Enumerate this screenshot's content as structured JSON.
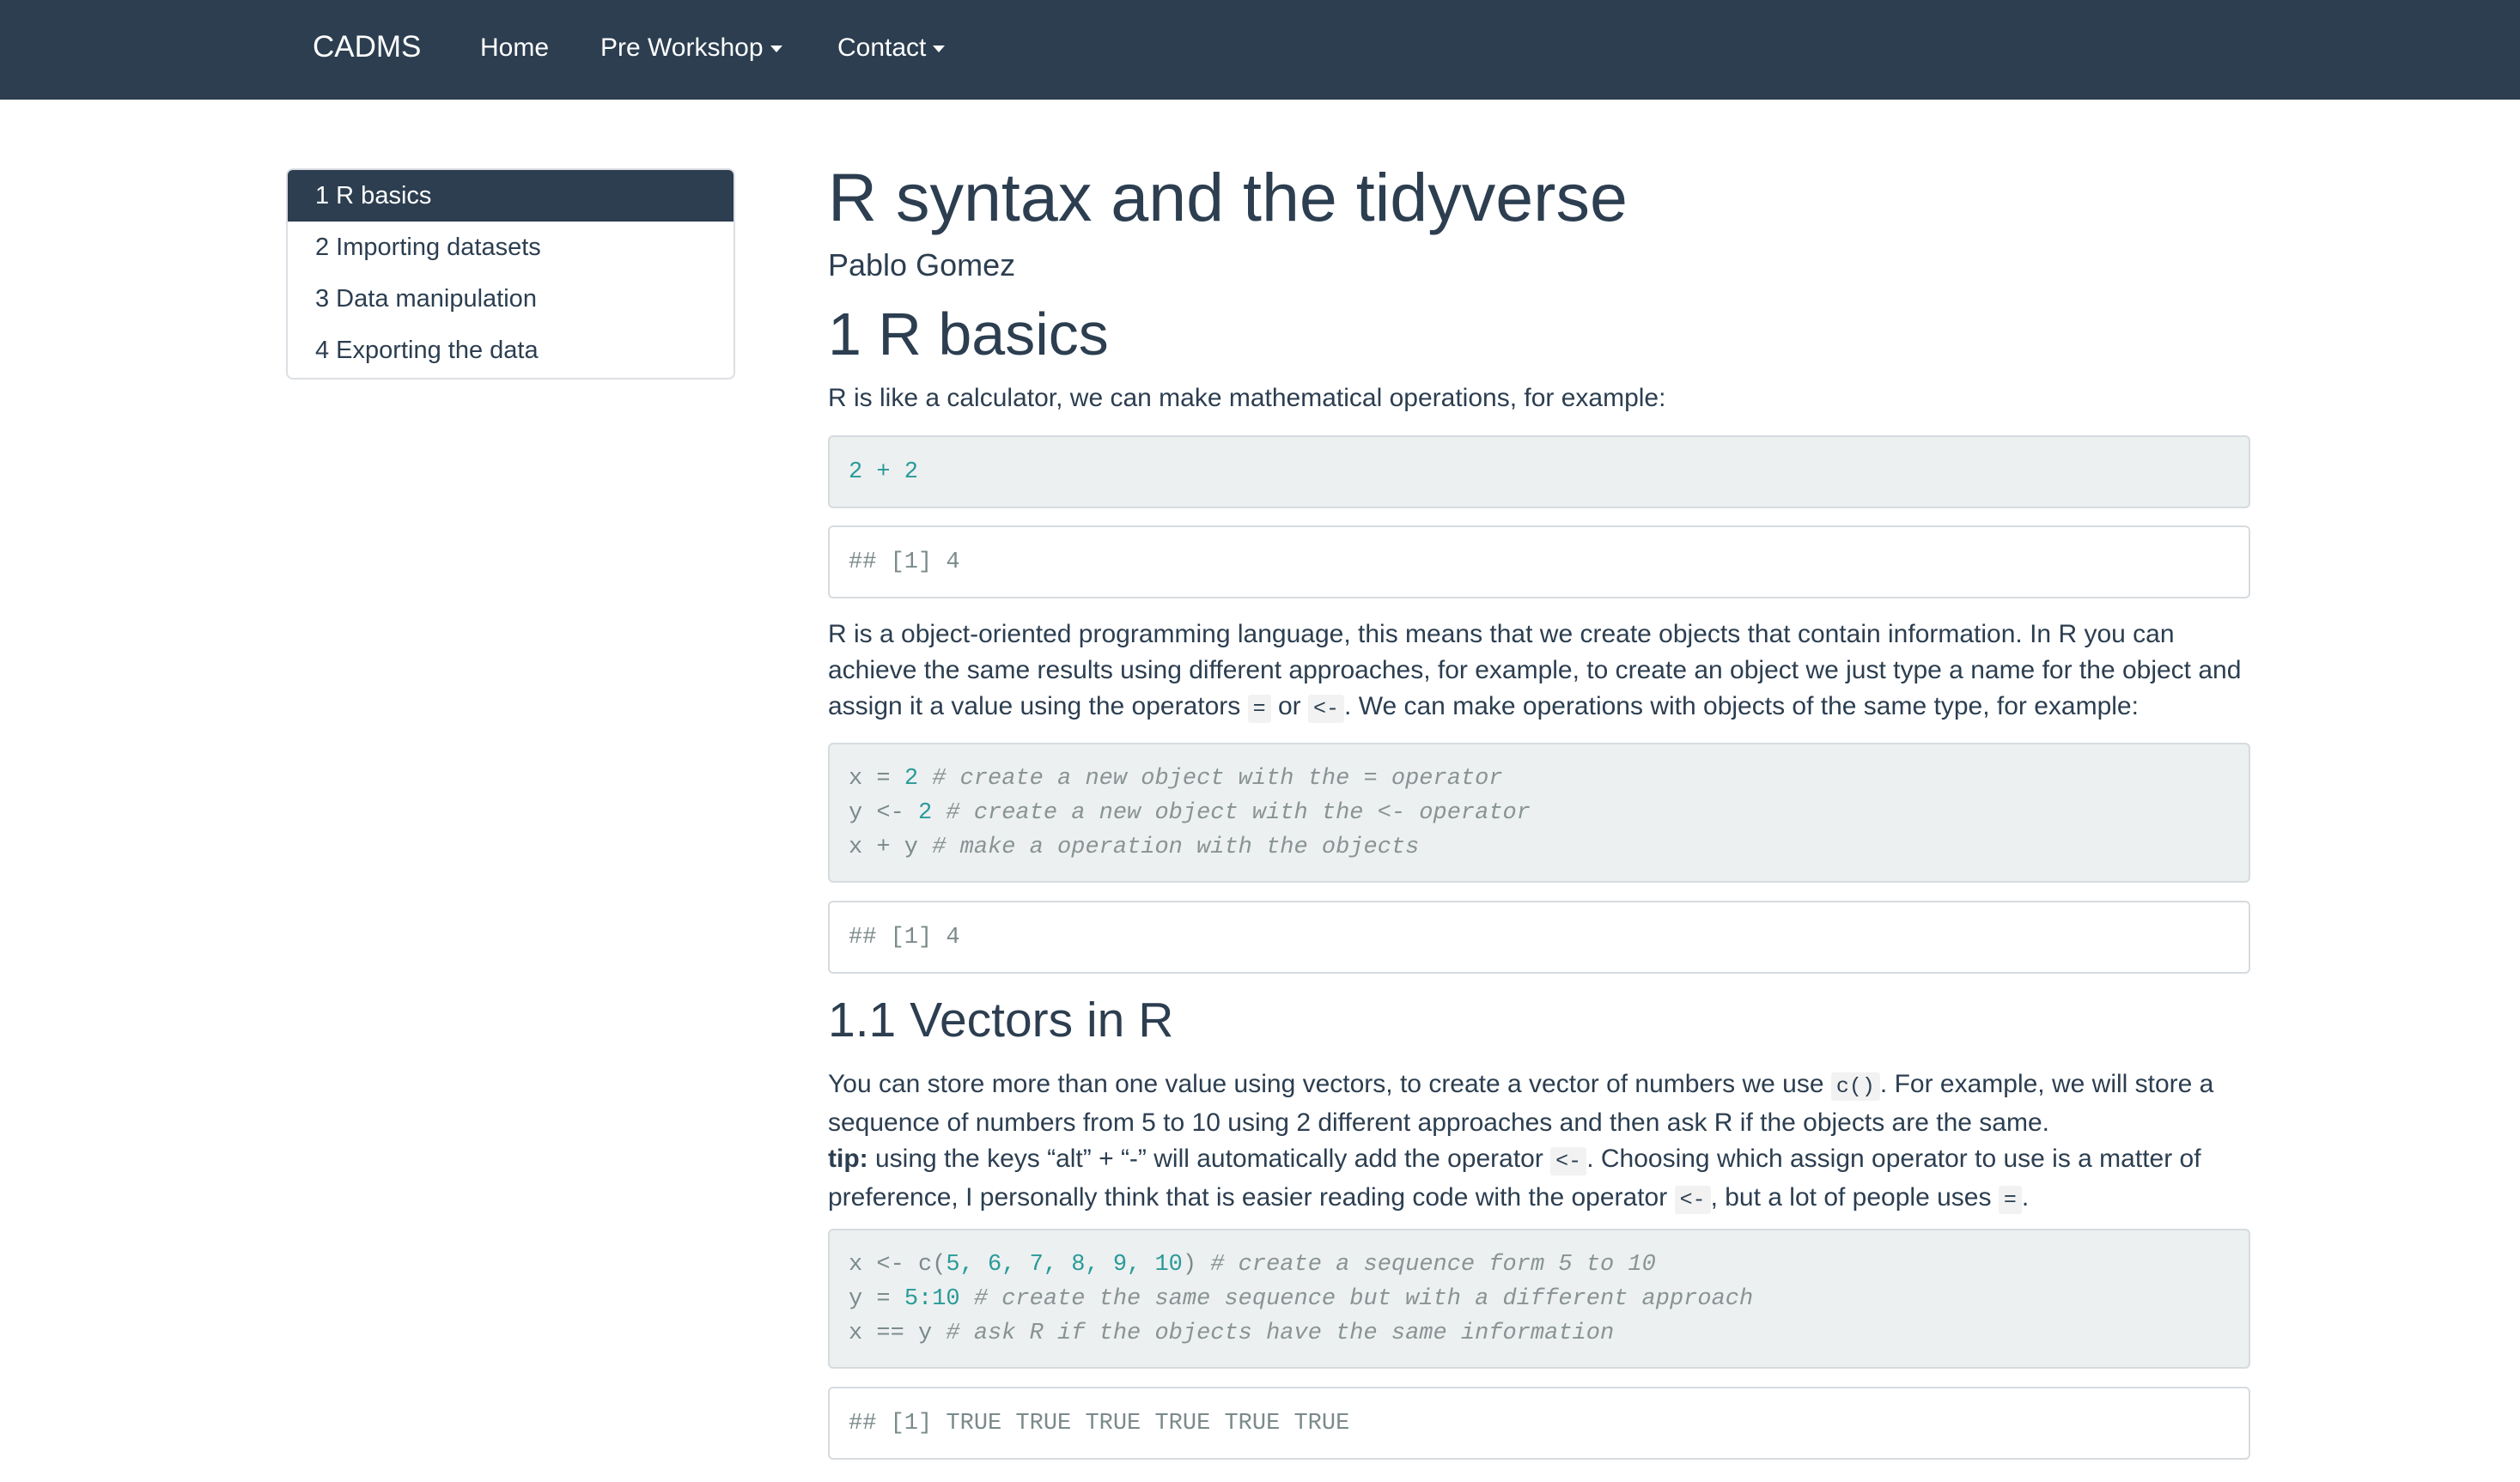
{
  "navbar": {
    "brand": "CADMS",
    "items": [
      {
        "label": "Home"
      },
      {
        "label": "Pre Workshop"
      },
      {
        "label": "Contact"
      }
    ]
  },
  "toc": {
    "items": [
      {
        "label": "1 R basics",
        "active": true
      },
      {
        "label": "2 Importing datasets"
      },
      {
        "label": "3 Data manipulation"
      },
      {
        "label": "4 Exporting the data"
      }
    ]
  },
  "main": {
    "title": "R syntax and the tidyverse",
    "author": "Pablo Gomez",
    "section1": "1 R basics",
    "para1": "R is like a calculator, we can make mathematical operations, for example:",
    "code1": {
      "lines": [
        [
          "2 + 2"
        ]
      ]
    },
    "out1": "## [1] 4",
    "para2_a": "R is a object-oriented programming language, this means that we create objects that contain information. In R you can achieve the same results using different approaches, for example, to create an object we just type a name for the object and assign it a value using the operators ",
    "para2_eq": "=",
    "para2_or": " or ",
    "para2_arrow": "<-",
    "para2_b": ". We can make operations with objects of the same type, for example:",
    "code2": {
      "l1_a": "x = ",
      "l1_num": "2",
      "l1_cmt": " # create a new object with the = operator",
      "l2_a": "y <- ",
      "l2_num": "2",
      "l2_cmt": " # create a new object with the <- operator",
      "l3_a": "x + y",
      "l3_cmt": " # make a operation with the objects"
    },
    "out2": "## [1] 4",
    "section11": "1.1 Vectors in R",
    "para3_a": "You can store more than one value using vectors, to create a vector of numbers we use ",
    "para3_c": "c()",
    "para3_b": ". For example, we will store a sequence of numbers from 5 to 10 using 2 different approaches and then ask R if the objects are the same.",
    "tip_label": "tip:",
    "tip_a": " using the keys “alt” + “-” will automatically add the operator ",
    "tip_arrow": "<-",
    "tip_b": ". Choosing which assign operator to use is a matter of preference, I personally think that is easier reading code with the operator ",
    "tip_arrow2": "<-",
    "tip_c": ", but a lot of people uses ",
    "tip_eq": "=",
    "tip_d": ".",
    "code3": {
      "l1_a": "x <- c(",
      "l1_nums": "5, 6, 7, 8, 9, 10",
      "l1_b": ")",
      "l1_cmt": " # create a sequence form 5 to 10",
      "l2_a": "y = ",
      "l2_num": "5:10",
      "l2_cmt": " # create the same sequence but with a different approach",
      "l3_a": "x == y",
      "l3_cmt": " # ask R if the objects have the same information"
    },
    "out3": "## [1] TRUE TRUE TRUE TRUE TRUE TRUE"
  }
}
